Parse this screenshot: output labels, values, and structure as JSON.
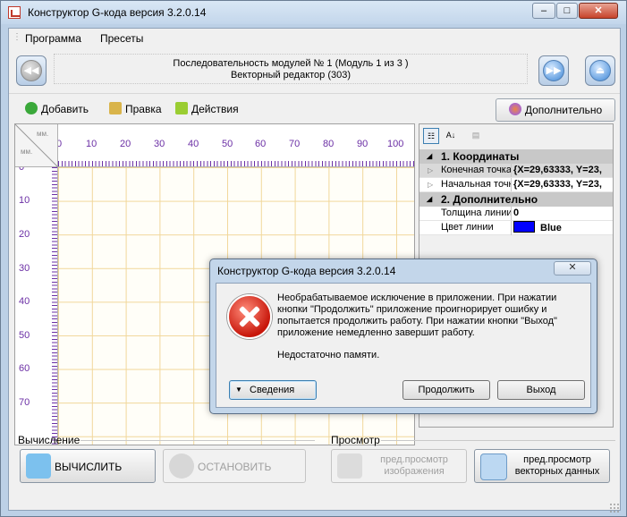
{
  "window": {
    "title": "Конструктор G-кода версия 3.2.0.14",
    "controls": [
      "–",
      "□",
      "✕"
    ]
  },
  "menu": [
    "Программа",
    "Пресеты"
  ],
  "sequence": {
    "line1": "Последовательность модулей № 1 (Модуль 1 из 3 )",
    "line2": "Векторный редактор (303)"
  },
  "toolbar": {
    "add": "Добавить",
    "edit": "Правка",
    "actions": "Действия",
    "more": "Дополнительно"
  },
  "ruler": {
    "corner_top": "мм.",
    "corner_left": "мм.",
    "x_ticks": [
      "0",
      "10",
      "20",
      "30",
      "40",
      "50",
      "60",
      "70",
      "80",
      "90",
      "100"
    ],
    "y_ticks": [
      "0",
      "10",
      "20",
      "30",
      "40",
      "50",
      "60",
      "70"
    ]
  },
  "properties": {
    "categories": [
      {
        "title": "1. Координаты",
        "rows": [
          {
            "name": "Конечная точка",
            "value": "{X=29,63333, Y=23,"
          },
          {
            "name": "Начальная точка",
            "value": "{X=29,63333, Y=23,"
          }
        ]
      },
      {
        "title": "2. Дополнительно",
        "rows": [
          {
            "name": "Толщина линии",
            "value": "0"
          },
          {
            "name": "Цвет линии",
            "value": "Blue",
            "color": "#0000ff"
          }
        ]
      }
    ]
  },
  "bottom": {
    "calc_group": "Вычисление",
    "calc_button": "ВЫЧИСЛИТЬ",
    "stop_button": "ОСТАНОВИТЬ",
    "preview_group": "Просмотр",
    "preview_image_l1": "пред.просмотр",
    "preview_image_l2": "изображения",
    "preview_vector_l1": "пред.просмотр",
    "preview_vector_l2": "векторных данных"
  },
  "dialog": {
    "title": "Конструктор G-кода версия 3.2.0.14",
    "message": "Необрабатываемое исключение в приложении. При нажатии кнопки \"Продолжить\" приложение проигнорирует ошибку и попытается продолжить работу. При нажатии кнопки \"Выход\" приложение немедленно завершит работу.",
    "detail": "Недостаточно памяти.",
    "details_button": "Сведения",
    "continue_button": "Продолжить",
    "exit_button": "Выход"
  }
}
